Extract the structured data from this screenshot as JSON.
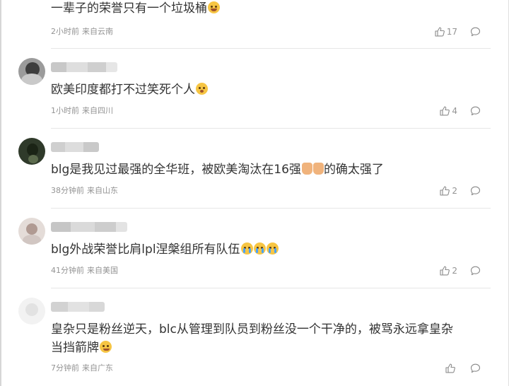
{
  "icons": {
    "like": "thumbs-up-icon",
    "reply": "comment-icon",
    "emoji": "emoji-icon"
  },
  "colors": {
    "text": "#333333",
    "meta": "#939393",
    "divider": "#e6e6e6"
  },
  "comments": [
    {
      "text": "一辈子的荣誉只有一个垃圾桶",
      "time": "2小时前",
      "source": "来自云南",
      "likes": "17",
      "emojis": [
        "grin"
      ]
    },
    {
      "text": "欧美印度都打不过笑死个人",
      "time": "1小时前",
      "source": "来自四川",
      "likes": "4",
      "emojis": [
        "tired"
      ]
    },
    {
      "text": "blg是我见过最强的全华班，被欧美淘汰在16强",
      "text2": "的确太强了",
      "time": "38分钟前",
      "source": "来自山东",
      "likes": "2",
      "emojis": [
        "thumb",
        "thumb"
      ]
    },
    {
      "text": "blg外战荣誉比肩lpl涅槃组所有队伍",
      "time": "41分钟前",
      "source": "来自美国",
      "likes": "2",
      "emojis": [
        "cry",
        "cry",
        "cry"
      ]
    },
    {
      "text": "皇杂只是粉丝逆天，blc从管理到队员到粉丝没一个干净的，被骂永远拿皇杂",
      "text2": "当挡箭牌",
      "time": "7分钟前",
      "source": "来自广东",
      "likes": "",
      "emojis": [
        "smirk"
      ]
    }
  ]
}
